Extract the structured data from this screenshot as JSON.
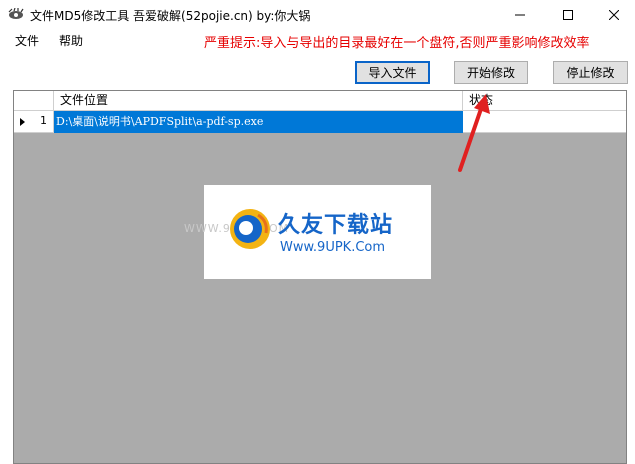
{
  "window": {
    "title": "文件MD5修改工具  吾爱破解(52pojie.cn)   by:你大锅",
    "app_icon": "eye-icon",
    "controls": [
      "minimize-icon",
      "maximize-icon",
      "close-icon"
    ]
  },
  "menu": {
    "file": "文件",
    "help": "帮助"
  },
  "warning": "严重提示:导入与导出的目录最好在一个盘符,否则严重影响修改效率",
  "toolbar": {
    "import_label": "导入文件",
    "start_label": "开始修改",
    "stop_label": "停止修改"
  },
  "table": {
    "columns": [
      "文件位置",
      "状态"
    ],
    "rows": [
      {
        "num": "1",
        "path": "D:\\桌面\\说明书\\APDFSplit\\a-pdf-sp.exe",
        "status": ""
      }
    ]
  },
  "watermark": {
    "site_left": "WWW.9UPK.COM",
    "brand": "久友下载站",
    "url": "Www.9UPK.Com"
  },
  "colors": {
    "accent": "#0078d7",
    "warning": "#e60000",
    "grid_background": "#ababab",
    "annotation_arrow": "#e02020"
  }
}
